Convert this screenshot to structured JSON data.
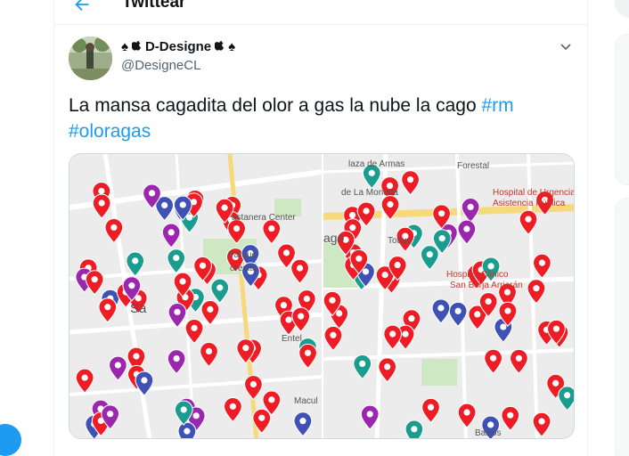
{
  "header": {
    "title": "Twittear"
  },
  "tweet": {
    "display_name": "D-Designe",
    "handle": "@DesigneCL",
    "text": "La mansa cagadita del olor a gas la nube la cago",
    "hashtags": [
      "#rm",
      "#oloragas"
    ]
  },
  "map_left": {
    "labels": [
      "astanera Center",
      "Parque",
      "orestal",
      "Sa",
      "Entel",
      "Macul"
    ]
  },
  "map_right": {
    "labels": [
      "laza de Armas",
      "Forestal",
      "de La Moneda",
      "Hospital de Urgencia",
      "Asistencia Pública",
      "Tottus",
      "ago",
      "Hospital Clínico",
      "San Borja Arriarán",
      "Barros"
    ]
  },
  "colors": {
    "accent": "#1d9bf0",
    "pin_red": "#ee1c24",
    "pin_purple": "#9b27af",
    "pin_teal": "#1a9d8f",
    "pin_blue": "#3f51b5",
    "map_bg": "#ececec"
  },
  "icons": [
    "back-arrow-icon",
    "spade-icon",
    "apple-icon",
    "caret-down-icon"
  ]
}
